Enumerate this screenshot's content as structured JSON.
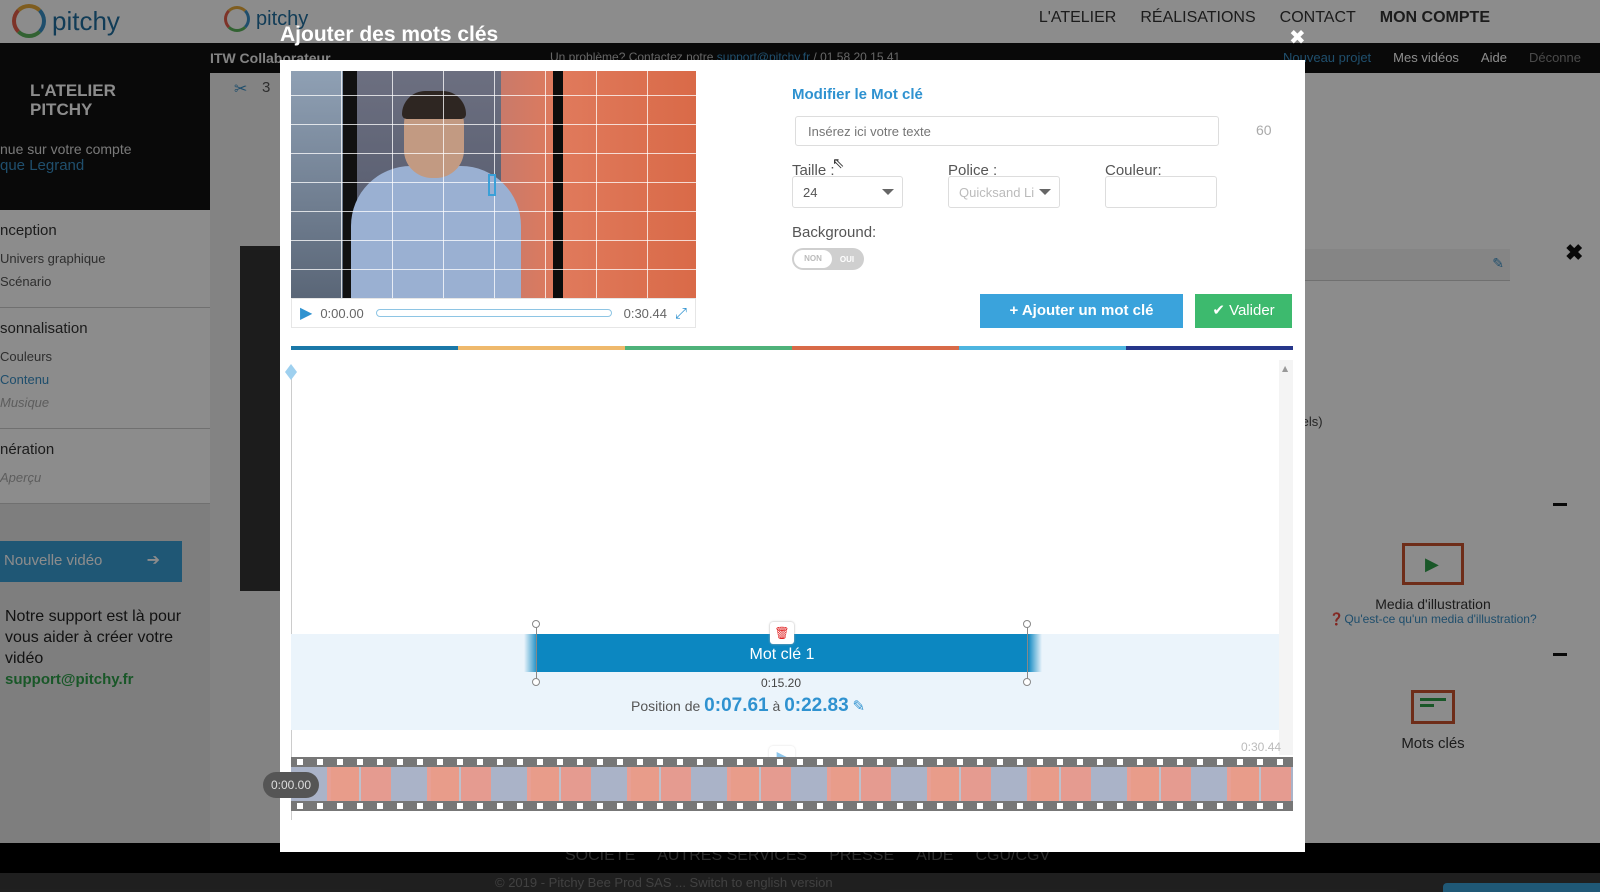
{
  "header": {
    "brand": "pitchy",
    "nav": [
      "L'ATELIER",
      "RÉALISATIONS",
      "CONTACT",
      "MON COMPTE"
    ]
  },
  "subbar": {
    "project_title": "ITW Collaborateur",
    "problem_text": "Un problème? Contactez notre ",
    "problem_email": "support@pitchy.fr",
    "problem_phone": " / 01 58 20 15 41",
    "links": [
      "Nouveau projet",
      "Mes vidéos",
      "Aide",
      "Déconne"
    ]
  },
  "sidebar": {
    "title_line1": "L'ATELIER",
    "title_line2": "PITCHY",
    "welcome": "nue sur votre compte",
    "user": "que Legrand",
    "sections": [
      {
        "heading": "nception",
        "items": [
          "Univers graphique",
          "Scénario"
        ]
      },
      {
        "heading": "sonnalisation",
        "items": [
          "Couleurs",
          "Contenu",
          "Musique"
        ]
      },
      {
        "heading": "nération",
        "items": [
          "Aperçu"
        ]
      }
    ],
    "new_video_label": "Nouvelle vidéo",
    "support_text": "Notre support est là pour vous aider à créer votre vidéo",
    "support_email": "support@pitchy.fr"
  },
  "content": {
    "scene_count": "3"
  },
  "right_panel": {
    "pixels_text": "pixels)",
    "media_label": "Media d'illustration",
    "media_help": "Qu'est-ce qu'un media d'illustration?",
    "keywords_label": "Mots clés"
  },
  "footer": {
    "nav": [
      "SOCIETE",
      "AUTRES SERVICES",
      "PRESSE",
      "AIDE",
      "CGU/CGV"
    ],
    "copyright": "© 2019 - Pitchy Bee Prod SAS ... Switch to english version"
  },
  "modal": {
    "title": "Ajouter des mots clés",
    "player": {
      "current_time": "0:00.00",
      "duration": "0:30.44",
      "progress": 0
    },
    "editor": {
      "title": "Modifier le Mot clé",
      "text_placeholder": "Insérez ici votre texte",
      "text_value": "",
      "char_count": "60",
      "size_label": "Taille :",
      "size_value": "24",
      "font_label": "Police :",
      "font_value": "Quicksand Li",
      "color_label": "Couleur:",
      "color_value": "",
      "background_label": "Background:",
      "toggle_off": "NON",
      "toggle_on": "OUI",
      "background_enabled": false
    },
    "buttons": {
      "add_keyword": "+ Ajouter un mot clé",
      "validate": "Valider"
    },
    "color_strip": [
      "#1a78a8",
      "#efb96c",
      "#4fb27a",
      "#d86a48",
      "#4db5e0",
      "#26368a"
    ],
    "timeline": {
      "keyword_label": "Mot clé 1",
      "keyword_duration": "0:15.20",
      "position_prefix": "Position de",
      "start": "0:07.61",
      "between": "à",
      "end": "0:22.83",
      "total_duration": "0:30.44",
      "cursor_time": "0:00.00"
    }
  }
}
